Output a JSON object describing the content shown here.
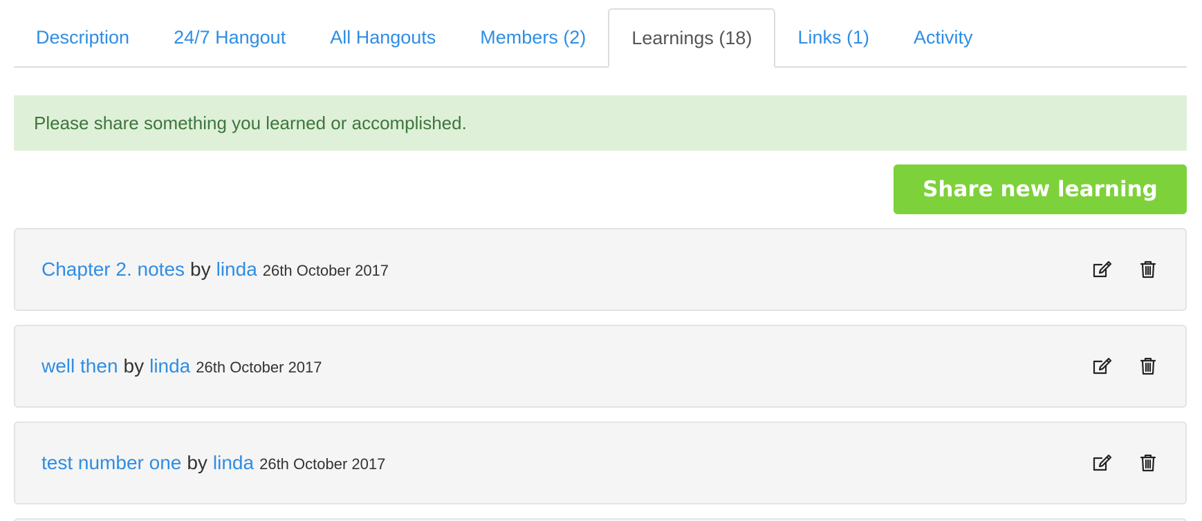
{
  "tabs": [
    {
      "label": "Description",
      "active": false
    },
    {
      "label": "24/7 Hangout",
      "active": false
    },
    {
      "label": "All Hangouts",
      "active": false
    },
    {
      "label": "Members (2)",
      "active": false
    },
    {
      "label": "Learnings (18)",
      "active": true
    },
    {
      "label": "Links (1)",
      "active": false
    },
    {
      "label": "Activity",
      "active": false
    }
  ],
  "alert": {
    "message": "Please share something you learned or accomplished."
  },
  "share_button": {
    "label": "Share new learning"
  },
  "learnings": [
    {
      "title": "Chapter 2. notes",
      "by": "by",
      "author": "linda",
      "date": "26th October 2017"
    },
    {
      "title": "well then",
      "by": "by",
      "author": "linda",
      "date": "26th October 2017"
    },
    {
      "title": "test number one",
      "by": "by",
      "author": "linda",
      "date": "26th October 2017"
    }
  ],
  "icons": {
    "edit": "edit-icon",
    "delete": "trash-icon"
  },
  "colors": {
    "link": "#2f8de4",
    "alert_bg": "#dff0d8",
    "alert_text": "#3c763d",
    "button_bg": "#7dd13a"
  }
}
